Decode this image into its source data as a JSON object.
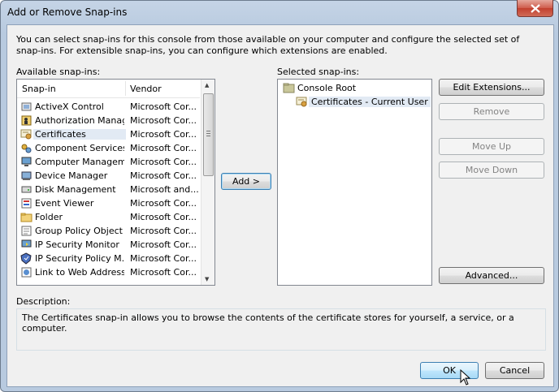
{
  "window": {
    "title": "Add or Remove Snap-ins",
    "close_label": "Close"
  },
  "intro_text": "You can select snap-ins for this console from those available on your computer and configure the selected set of snap-ins. For extensible snap-ins, you can configure which extensions are enabled.",
  "available": {
    "label": "Available snap-ins:",
    "columns": {
      "snapin": "Snap-in",
      "vendor": "Vendor"
    },
    "items": [
      {
        "name": "ActiveX Control",
        "vendor": "Microsoft Cor...",
        "icon": "activex-control-icon"
      },
      {
        "name": "Authorization Manager",
        "vendor": "Microsoft Cor...",
        "icon": "authorization-manager-icon"
      },
      {
        "name": "Certificates",
        "vendor": "Microsoft Cor...",
        "icon": "certificates-icon",
        "selected": true
      },
      {
        "name": "Component Services",
        "vendor": "Microsoft Cor...",
        "icon": "component-services-icon"
      },
      {
        "name": "Computer Managem...",
        "vendor": "Microsoft Cor...",
        "icon": "computer-management-icon"
      },
      {
        "name": "Device Manager",
        "vendor": "Microsoft Cor...",
        "icon": "device-manager-icon"
      },
      {
        "name": "Disk Management",
        "vendor": "Microsoft and...",
        "icon": "disk-management-icon"
      },
      {
        "name": "Event Viewer",
        "vendor": "Microsoft Cor...",
        "icon": "event-viewer-icon"
      },
      {
        "name": "Folder",
        "vendor": "Microsoft Cor...",
        "icon": "folder-icon"
      },
      {
        "name": "Group Policy Object ...",
        "vendor": "Microsoft Cor...",
        "icon": "group-policy-icon"
      },
      {
        "name": "IP Security Monitor",
        "vendor": "Microsoft Cor...",
        "icon": "ip-security-monitor-icon"
      },
      {
        "name": "IP Security Policy M...",
        "vendor": "Microsoft Cor...",
        "icon": "ip-security-policy-icon"
      },
      {
        "name": "Link to Web Address",
        "vendor": "Microsoft Cor...",
        "icon": "link-web-address-icon"
      }
    ]
  },
  "buttons": {
    "add": "Add >",
    "edit_extensions": "Edit Extensions...",
    "remove": "Remove",
    "move_up": "Move Up",
    "move_down": "Move Down",
    "advanced": "Advanced...",
    "ok": "OK",
    "cancel": "Cancel"
  },
  "selected": {
    "label": "Selected snap-ins:",
    "root": "Console Root",
    "child": "Certificates - Current User"
  },
  "description": {
    "label": "Description:",
    "text": "The Certificates snap-in allows you to browse the contents of the certificate stores for yourself, a service, or a computer."
  },
  "colors": {
    "accent": "#3c7fb1",
    "selection": "#e2eaf4",
    "close_red": "#c2402f"
  }
}
